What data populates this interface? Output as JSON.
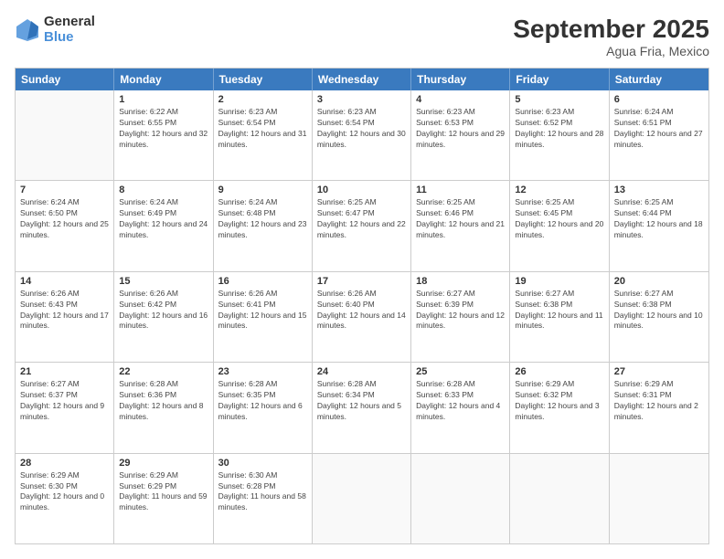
{
  "header": {
    "logo": {
      "line1": "General",
      "line2": "Blue"
    },
    "title": "September 2025",
    "subtitle": "Agua Fria, Mexico"
  },
  "calendar": {
    "days_of_week": [
      "Sunday",
      "Monday",
      "Tuesday",
      "Wednesday",
      "Thursday",
      "Friday",
      "Saturday"
    ],
    "weeks": [
      [
        {
          "day": "",
          "empty": true
        },
        {
          "day": "1",
          "sunrise": "6:22 AM",
          "sunset": "6:55 PM",
          "daylight": "12 hours and 32 minutes."
        },
        {
          "day": "2",
          "sunrise": "6:23 AM",
          "sunset": "6:54 PM",
          "daylight": "12 hours and 31 minutes."
        },
        {
          "day": "3",
          "sunrise": "6:23 AM",
          "sunset": "6:54 PM",
          "daylight": "12 hours and 30 minutes."
        },
        {
          "day": "4",
          "sunrise": "6:23 AM",
          "sunset": "6:53 PM",
          "daylight": "12 hours and 29 minutes."
        },
        {
          "day": "5",
          "sunrise": "6:23 AM",
          "sunset": "6:52 PM",
          "daylight": "12 hours and 28 minutes."
        },
        {
          "day": "6",
          "sunrise": "6:24 AM",
          "sunset": "6:51 PM",
          "daylight": "12 hours and 27 minutes."
        }
      ],
      [
        {
          "day": "7",
          "sunrise": "6:24 AM",
          "sunset": "6:50 PM",
          "daylight": "12 hours and 25 minutes."
        },
        {
          "day": "8",
          "sunrise": "6:24 AM",
          "sunset": "6:49 PM",
          "daylight": "12 hours and 24 minutes."
        },
        {
          "day": "9",
          "sunrise": "6:24 AM",
          "sunset": "6:48 PM",
          "daylight": "12 hours and 23 minutes."
        },
        {
          "day": "10",
          "sunrise": "6:25 AM",
          "sunset": "6:47 PM",
          "daylight": "12 hours and 22 minutes."
        },
        {
          "day": "11",
          "sunrise": "6:25 AM",
          "sunset": "6:46 PM",
          "daylight": "12 hours and 21 minutes."
        },
        {
          "day": "12",
          "sunrise": "6:25 AM",
          "sunset": "6:45 PM",
          "daylight": "12 hours and 20 minutes."
        },
        {
          "day": "13",
          "sunrise": "6:25 AM",
          "sunset": "6:44 PM",
          "daylight": "12 hours and 18 minutes."
        }
      ],
      [
        {
          "day": "14",
          "sunrise": "6:26 AM",
          "sunset": "6:43 PM",
          "daylight": "12 hours and 17 minutes."
        },
        {
          "day": "15",
          "sunrise": "6:26 AM",
          "sunset": "6:42 PM",
          "daylight": "12 hours and 16 minutes."
        },
        {
          "day": "16",
          "sunrise": "6:26 AM",
          "sunset": "6:41 PM",
          "daylight": "12 hours and 15 minutes."
        },
        {
          "day": "17",
          "sunrise": "6:26 AM",
          "sunset": "6:40 PM",
          "daylight": "12 hours and 14 minutes."
        },
        {
          "day": "18",
          "sunrise": "6:27 AM",
          "sunset": "6:39 PM",
          "daylight": "12 hours and 12 minutes."
        },
        {
          "day": "19",
          "sunrise": "6:27 AM",
          "sunset": "6:38 PM",
          "daylight": "12 hours and 11 minutes."
        },
        {
          "day": "20",
          "sunrise": "6:27 AM",
          "sunset": "6:38 PM",
          "daylight": "12 hours and 10 minutes."
        }
      ],
      [
        {
          "day": "21",
          "sunrise": "6:27 AM",
          "sunset": "6:37 PM",
          "daylight": "12 hours and 9 minutes."
        },
        {
          "day": "22",
          "sunrise": "6:28 AM",
          "sunset": "6:36 PM",
          "daylight": "12 hours and 8 minutes."
        },
        {
          "day": "23",
          "sunrise": "6:28 AM",
          "sunset": "6:35 PM",
          "daylight": "12 hours and 6 minutes."
        },
        {
          "day": "24",
          "sunrise": "6:28 AM",
          "sunset": "6:34 PM",
          "daylight": "12 hours and 5 minutes."
        },
        {
          "day": "25",
          "sunrise": "6:28 AM",
          "sunset": "6:33 PM",
          "daylight": "12 hours and 4 minutes."
        },
        {
          "day": "26",
          "sunrise": "6:29 AM",
          "sunset": "6:32 PM",
          "daylight": "12 hours and 3 minutes."
        },
        {
          "day": "27",
          "sunrise": "6:29 AM",
          "sunset": "6:31 PM",
          "daylight": "12 hours and 2 minutes."
        }
      ],
      [
        {
          "day": "28",
          "sunrise": "6:29 AM",
          "sunset": "6:30 PM",
          "daylight": "12 hours and 0 minutes."
        },
        {
          "day": "29",
          "sunrise": "6:29 AM",
          "sunset": "6:29 PM",
          "daylight": "11 hours and 59 minutes."
        },
        {
          "day": "30",
          "sunrise": "6:30 AM",
          "sunset": "6:28 PM",
          "daylight": "11 hours and 58 minutes."
        },
        {
          "day": "",
          "empty": true
        },
        {
          "day": "",
          "empty": true
        },
        {
          "day": "",
          "empty": true
        },
        {
          "day": "",
          "empty": true
        }
      ]
    ]
  }
}
